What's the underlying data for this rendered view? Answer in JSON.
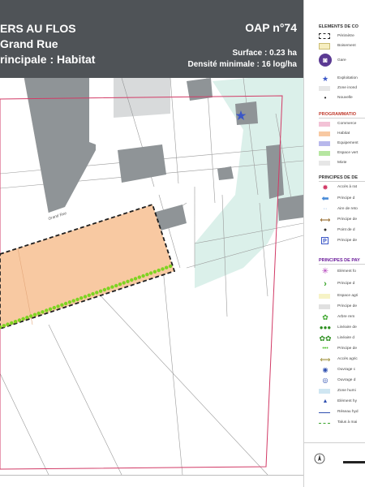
{
  "header": {
    "title_line1": "ERS AU FLOS",
    "title_line2": "Grand Rue",
    "title_line3": "rincipale : Habitat",
    "oap_label": "OAP n°74",
    "surface": "Surface : 0.23 ha",
    "densite": "Densité minimale : 16 log/ha"
  },
  "map": {
    "street_label": "Grand Rue",
    "colors": {
      "habitat": "#f8c9a2",
      "building": "#8f9497",
      "zone_humide": "#d7eee8",
      "frontage_dots": "#7ed321",
      "perimeter": "#1f1f1f",
      "boundary_red": "#d23a66",
      "star": "#3a56c7"
    }
  },
  "legend": {
    "sec_elements": "ELEMENTS DE CO",
    "elements_items": [
      "Périmètre",
      "Boisement",
      "Gare",
      "Exploitation",
      "Zone inond",
      "Nouvelle"
    ],
    "sec_programmation": "PROGRAMMATIO",
    "programmation_items": [
      "Commerce",
      "Habitat",
      "Equipement",
      "Espace vert",
      "Mixte"
    ],
    "sec_principes_de": "PRINCIPES DE DE",
    "principes_de_items": [
      "Accès à rat",
      "Principe d",
      "Aire de reto",
      "Principe de",
      "Point de d",
      "Principe de"
    ],
    "sec_principes_pay": "PRINCIPES DE PAY",
    "principes_pay_items": [
      "Elément fo",
      "Principe d",
      "Espace agri",
      "Principe de",
      "Arbre rem",
      "Linéaire de",
      "Linéaire d",
      "Principe de",
      "Accès agric",
      "Ouvrage c",
      "Ouvrage d",
      "Zone humi",
      "Elément hy",
      "Réseau hyd",
      "Talus à mai"
    ]
  }
}
